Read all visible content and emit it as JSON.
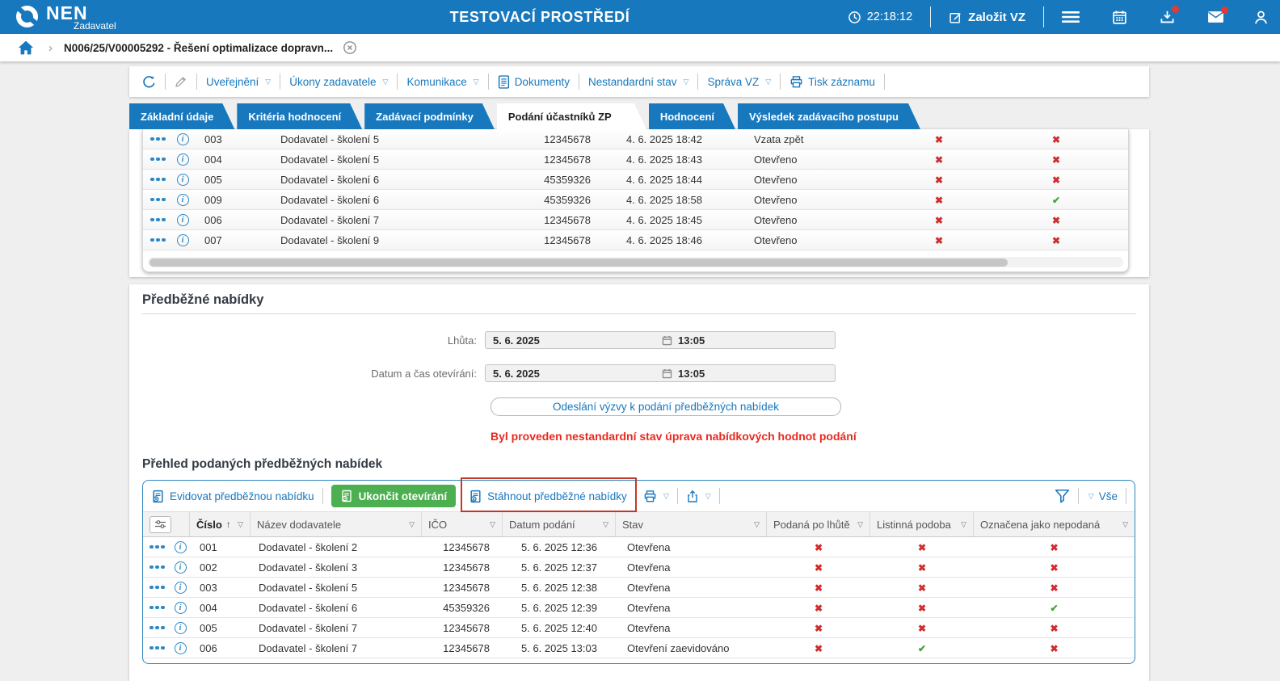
{
  "topbar": {
    "brand": "NEN",
    "brand_sub": "Zadavatel",
    "env_title": "TESTOVACÍ PROSTŘEDÍ",
    "time": "22:18:12",
    "create_vz": "Založit VZ",
    "icons": [
      "clock-icon",
      "edit-icon",
      "menu-icon",
      "calendar-icon",
      "download-icon",
      "mail-icon",
      "user-icon"
    ],
    "notification_dot_color": "#e53935"
  },
  "breadcrumb": {
    "record": "N006/25/V00005292 - Řešení optimalizace dopravn..."
  },
  "record_toolbar": {
    "items": [
      {
        "icon": "refresh-icon"
      },
      {
        "icon": "pencil-icon",
        "disabled": true
      },
      {
        "label": "Uveřejnění",
        "caret": true
      },
      {
        "label": "Úkony zadavatele",
        "caret": true
      },
      {
        "label": "Komunikace",
        "caret": true
      },
      {
        "icon": "document-icon",
        "label": "Dokumenty"
      },
      {
        "label": "Nestandardní stav",
        "caret": true
      },
      {
        "label": "Správa VZ",
        "caret": true
      },
      {
        "icon": "printer-icon",
        "label": "Tisk záznamu"
      }
    ]
  },
  "tabs": [
    {
      "label": "Základní údaje",
      "active": false
    },
    {
      "label": "Kritéria hodnocení",
      "active": false
    },
    {
      "label": "Zadávací podmínky",
      "active": false
    },
    {
      "label": "Podání účastníků ZP",
      "active": true
    },
    {
      "label": "Hodnocení",
      "active": false
    },
    {
      "label": "Výsledek zadávacího postupu",
      "active": false
    }
  ],
  "participants_table": {
    "rows": [
      {
        "num": "003",
        "supplier": "Dodavatel - školení 5",
        "ico": "12345678",
        "submitted": "4. 6. 2025 18:42",
        "state": "Vzata zpět",
        "mark1": "x",
        "mark2": "x"
      },
      {
        "num": "004",
        "supplier": "Dodavatel - školení 5",
        "ico": "12345678",
        "submitted": "4. 6. 2025 18:43",
        "state": "Otevřeno",
        "mark1": "x",
        "mark2": "x"
      },
      {
        "num": "005",
        "supplier": "Dodavatel - školení 6",
        "ico": "45359326",
        "submitted": "4. 6. 2025 18:44",
        "state": "Otevřeno",
        "mark1": "x",
        "mark2": "x"
      },
      {
        "num": "009",
        "supplier": "Dodavatel - školení 6",
        "ico": "45359326",
        "submitted": "4. 6. 2025 18:58",
        "state": "Otevřeno",
        "mark1": "x",
        "mark2": "check"
      },
      {
        "num": "006",
        "supplier": "Dodavatel - školení 7",
        "ico": "12345678",
        "submitted": "4. 6. 2025 18:45",
        "state": "Otevřeno",
        "mark1": "x",
        "mark2": "x"
      },
      {
        "num": "007",
        "supplier": "Dodavatel - školení 9",
        "ico": "12345678",
        "submitted": "4. 6. 2025 18:46",
        "state": "Otevřeno",
        "mark1": "x",
        "mark2": "x"
      }
    ]
  },
  "preliminary": {
    "title": "Předběžné nabídky",
    "deadline_label": "Lhůta:",
    "deadline_date": "5. 6. 2025",
    "deadline_time": "13:05",
    "opening_label": "Datum a čas otevírání:",
    "opening_date": "5. 6. 2025",
    "opening_time": "13:05",
    "send_button": "Odeslání výzvy k podání předběžných nabídek",
    "warning": "Byl proveden nestandardní stav úprava nabídkových hodnot podání"
  },
  "overview": {
    "title": "Přehled podaných předběžných nabídek",
    "toolbar": {
      "add": "Evidovat předběžnou nabídku",
      "finish": "Ukončit otevírání",
      "download": "Stáhnout předběžné nabídky",
      "all": "Vše"
    },
    "highlight_color": "#c0392b",
    "sorted_column": "Číslo",
    "columns": [
      "Číslo",
      "Název dodavatele",
      "IČO",
      "Datum podání",
      "Stav",
      "Podaná po lhůtě",
      "Listinná podoba",
      "Označena jako nepodaná"
    ],
    "rows": [
      {
        "num": "001",
        "supplier": "Dodavatel - školení 2",
        "ico": "12345678",
        "submitted": "5. 6. 2025 12:36",
        "state": "Otevřena",
        "late": "x",
        "paper": "x",
        "not_submitted": "x"
      },
      {
        "num": "002",
        "supplier": "Dodavatel - školení 3",
        "ico": "12345678",
        "submitted": "5. 6. 2025 12:37",
        "state": "Otevřena",
        "late": "x",
        "paper": "x",
        "not_submitted": "x"
      },
      {
        "num": "003",
        "supplier": "Dodavatel - školení 5",
        "ico": "12345678",
        "submitted": "5. 6. 2025 12:38",
        "state": "Otevřena",
        "late": "x",
        "paper": "x",
        "not_submitted": "x"
      },
      {
        "num": "004",
        "supplier": "Dodavatel - školení 6",
        "ico": "45359326",
        "submitted": "5. 6. 2025 12:39",
        "state": "Otevřena",
        "late": "x",
        "paper": "x",
        "not_submitted": "check"
      },
      {
        "num": "005",
        "supplier": "Dodavatel - školení 7",
        "ico": "12345678",
        "submitted": "5. 6. 2025 12:40",
        "state": "Otevřena",
        "late": "x",
        "paper": "x",
        "not_submitted": "x"
      },
      {
        "num": "006",
        "supplier": "Dodavatel - školení 7",
        "ico": "12345678",
        "submitted": "5. 6. 2025 13:03",
        "state": "Otevření zaevidováno",
        "late": "x",
        "paper": "check",
        "not_submitted": "x"
      }
    ]
  },
  "colors": {
    "topbar_blue": "#1878be",
    "accent_blue": "#1878be",
    "green_button": "#4caf50",
    "x_mark": "#cf2e2e",
    "check_mark": "#3fa535",
    "warning_text": "#e8291f"
  }
}
